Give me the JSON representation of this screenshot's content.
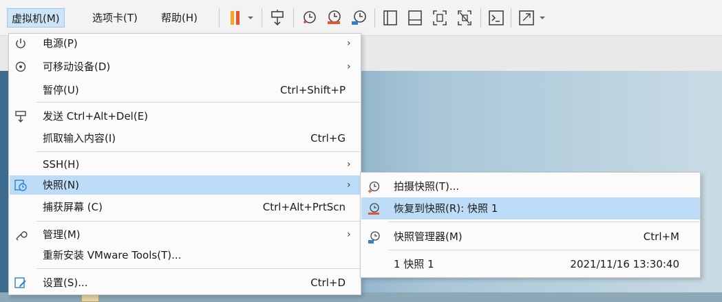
{
  "menubar": {
    "items": [
      {
        "label": "虚拟机(M)"
      },
      {
        "label": "选项卡(T)"
      },
      {
        "label": "帮助(H)"
      }
    ]
  },
  "toolbar": {
    "pause_color": "#f5a623",
    "icons": [
      "pause-icon",
      "send-ctrl-alt-del-icon",
      "take-snapshot-icon",
      "revert-snapshot-icon",
      "snapshot-manager-icon",
      "library-view-icon",
      "console-view-icon",
      "fit-guest-icon",
      "unity-icon",
      "terminal-icon",
      "fullscreen-icon"
    ]
  },
  "vm_menu": {
    "items": [
      {
        "label": "电源(P)",
        "shortcut": "",
        "has_submenu": true
      },
      {
        "label": "可移动设备(D)",
        "shortcut": "",
        "has_submenu": true
      },
      {
        "label": "暂停(U)",
        "shortcut": "Ctrl+Shift+P",
        "has_submenu": false
      },
      {
        "label": "发送 Ctrl+Alt+Del(E)",
        "shortcut": "",
        "has_submenu": false
      },
      {
        "label": "抓取输入内容(I)",
        "shortcut": "Ctrl+G",
        "has_submenu": false
      },
      {
        "label": "SSH(H)",
        "shortcut": "",
        "has_submenu": true
      },
      {
        "label": "快照(N)",
        "shortcut": "",
        "has_submenu": true
      },
      {
        "label": "捕获屏幕 (C)",
        "shortcut": "Ctrl+Alt+PrtScn",
        "has_submenu": false
      },
      {
        "label": "管理(M)",
        "shortcut": "",
        "has_submenu": true
      },
      {
        "label": "重新安装 VMware Tools(T)...",
        "shortcut": "",
        "has_submenu": false
      },
      {
        "label": "设置(S)...",
        "shortcut": "Ctrl+D",
        "has_submenu": false
      }
    ],
    "submenu_arrow": "›"
  },
  "snapshot_menu": {
    "items": [
      {
        "label": "拍摄快照(T)...",
        "shortcut": ""
      },
      {
        "label": "恢复到快照(R): 快照 1",
        "shortcut": ""
      },
      {
        "label": "快照管理器(M)",
        "shortcut": "Ctrl+M"
      },
      {
        "label": "1  快照 1",
        "shortcut": "2021/11/16 13:30:40"
      }
    ]
  },
  "colors": {
    "highlight": "#bcdcf7",
    "accent_blue": "#2f7fd0",
    "revert_red": "#e2572b"
  }
}
